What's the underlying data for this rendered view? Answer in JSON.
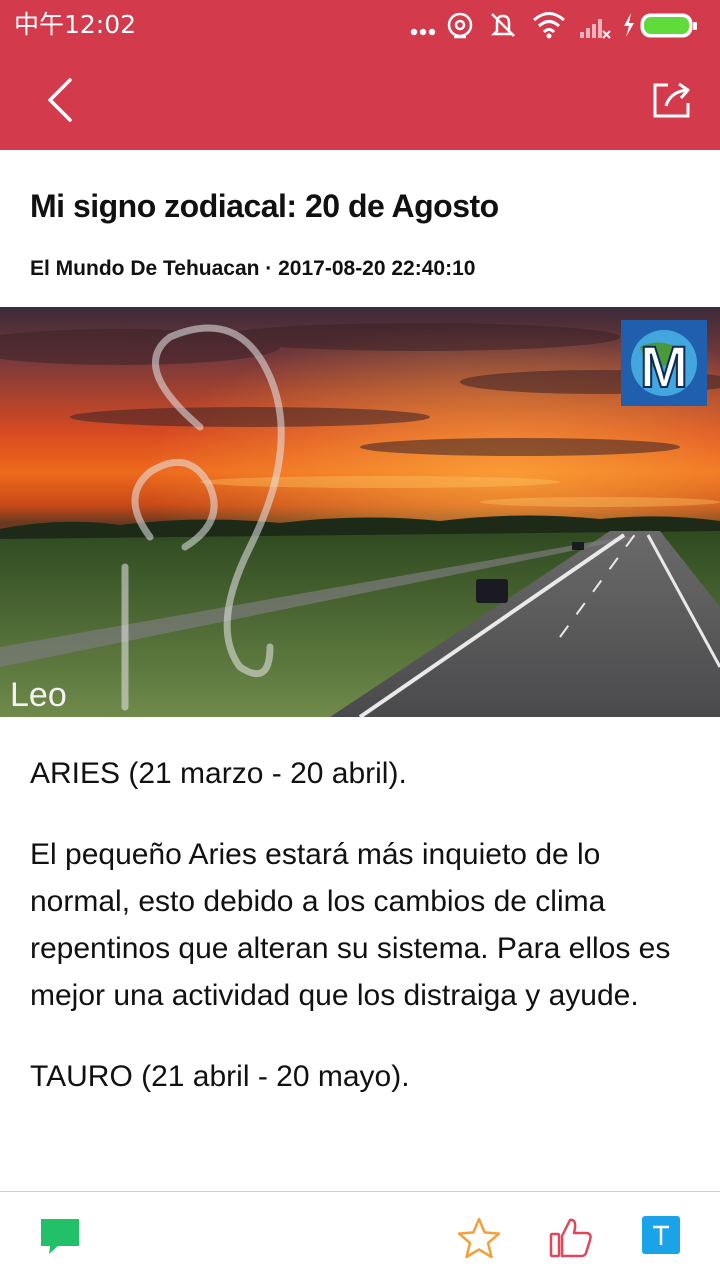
{
  "status_bar": {
    "time": "中午12:02"
  },
  "article": {
    "title": "Mi signo zodiacal: 20 de Agosto",
    "byline": "El Mundo De Tehuacan · 2017-08-20 22:40:10",
    "image_caption": "Leo",
    "paragraphs": [
      "ARIES (21 marzo - 20 abril).",
      "El pequeño Aries estará más inquieto de lo normal, esto debido a los cambios de clima repentinos que alteran su sistema. Para ellos es mejor una actividad que los distraiga y ayude.",
      "TAURO (21 abril - 20 mayo)."
    ]
  },
  "colors": {
    "header_red": "#d33a4c",
    "comment_green": "#23c06a",
    "star_orange": "#f2a13a",
    "like_red": "#e0485a",
    "font_blue": "#1aa3e8"
  },
  "icons": {
    "back": "chevron-left-icon",
    "share": "share-icon",
    "comment": "comment-icon",
    "favorite": "star-icon",
    "like": "thumbs-up-icon",
    "text_size": "text-size-icon"
  },
  "logo_letter": "M"
}
